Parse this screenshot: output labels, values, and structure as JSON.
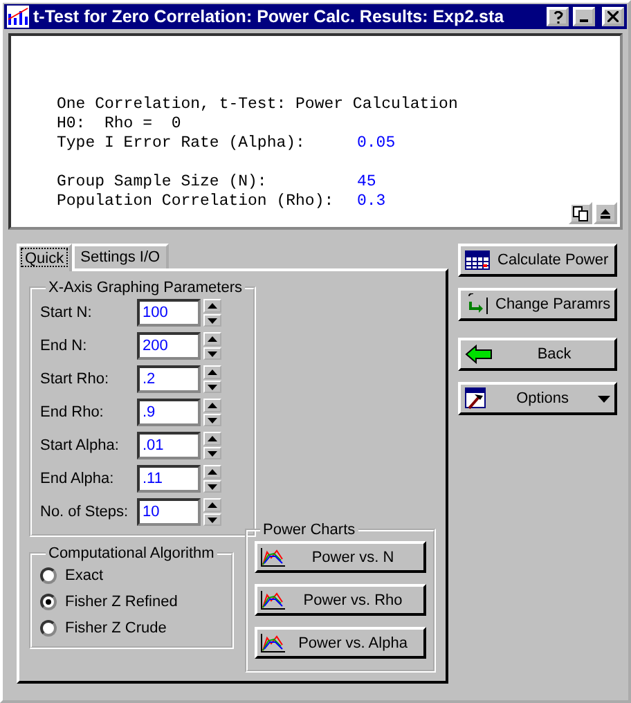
{
  "window": {
    "title": "t-Test for Zero Correlation: Power Calc. Results: Exp2.sta"
  },
  "results": [
    {
      "label": "One Correlation, t-Test: Power Calculation"
    },
    {
      "label": "H0:  Rho =  0"
    },
    {
      "label": "Type I Error Rate (Alpha):",
      "value": "0.05"
    },
    {
      "label": "Group Sample Size (N):",
      "value": "45",
      "gap_before": true
    },
    {
      "label": "Population Correlation (Rho):",
      "value": "0.3"
    }
  ],
  "tabs": [
    {
      "label": "Quick",
      "selected": true
    },
    {
      "label": "Settings I/O",
      "selected": false
    }
  ],
  "x_axis_group": {
    "title": "X-Axis Graphing Parameters",
    "fields": [
      {
        "label": "Start  N:",
        "value": "100"
      },
      {
        "label": "End N:",
        "value": "200"
      },
      {
        "label": "Start Rho:",
        "value": ".2"
      },
      {
        "label": "End Rho:",
        "value": ".9"
      },
      {
        "label": "Start Alpha:",
        "value": ".01"
      },
      {
        "label": "End Alpha:",
        "value": ".11"
      },
      {
        "label": "No. of Steps:",
        "value": "10"
      }
    ]
  },
  "algorithm_group": {
    "title": "Computational Algorithm",
    "options": [
      {
        "label": "Exact",
        "selected": false
      },
      {
        "label": "Fisher Z Refined",
        "selected": true
      },
      {
        "label": "Fisher Z Crude",
        "selected": false
      }
    ]
  },
  "charts_group": {
    "title": "Power Charts",
    "buttons": [
      "Power vs. N",
      "Power vs. Rho",
      "Power vs. Alpha"
    ]
  },
  "side_buttons": [
    {
      "label": "Calculate Power",
      "kind": "sum"
    },
    {
      "label": "Change Paramrs",
      "kind": "change"
    },
    {
      "label": "Back",
      "kind": "back"
    },
    {
      "label": "Options",
      "kind": "options"
    }
  ]
}
